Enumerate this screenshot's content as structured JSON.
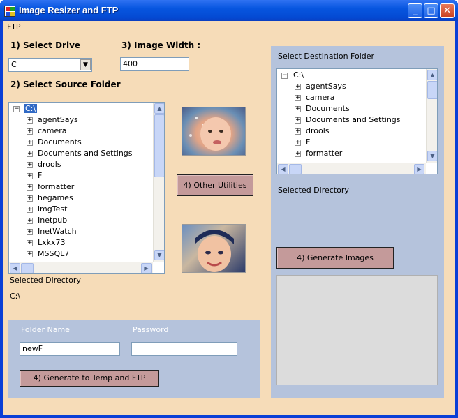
{
  "window": {
    "title": "Image Resizer and FTP",
    "minimize": "_",
    "maximize": "□",
    "close": "✕"
  },
  "menu": {
    "items": [
      "FTP"
    ]
  },
  "drive": {
    "label": "1) Select Drive",
    "value": "C"
  },
  "width": {
    "label": "3) Image Width :",
    "value": "400"
  },
  "source": {
    "label": "2) Select Source Folder",
    "root": "C:\\",
    "items": [
      "agentSays",
      "camera",
      "Documents",
      "Documents and Settings",
      "drools",
      "F",
      "formatter",
      "hegames",
      "imgTest",
      "Inetpub",
      "InetWatch",
      "Lxkx73",
      "MSSQL7"
    ],
    "selected_dir_label": "Selected Directory",
    "selected_dir_value": "C:\\"
  },
  "utilities": {
    "button": "4) Other Utilities"
  },
  "destination": {
    "label": "Select Destination Folder",
    "root": "C:\\",
    "items": [
      "agentSays",
      "camera",
      "Documents",
      "Documents and Settings",
      "drools",
      "F",
      "formatter"
    ],
    "selected_dir_label": "Selected Directory",
    "generate_button": "4) Generate Images"
  },
  "ftp": {
    "folder_label": "Folder Name",
    "folder_value": "newF",
    "password_label": "Password",
    "password_value": "",
    "generate_button": "4) Generate to Temp and FTP"
  }
}
